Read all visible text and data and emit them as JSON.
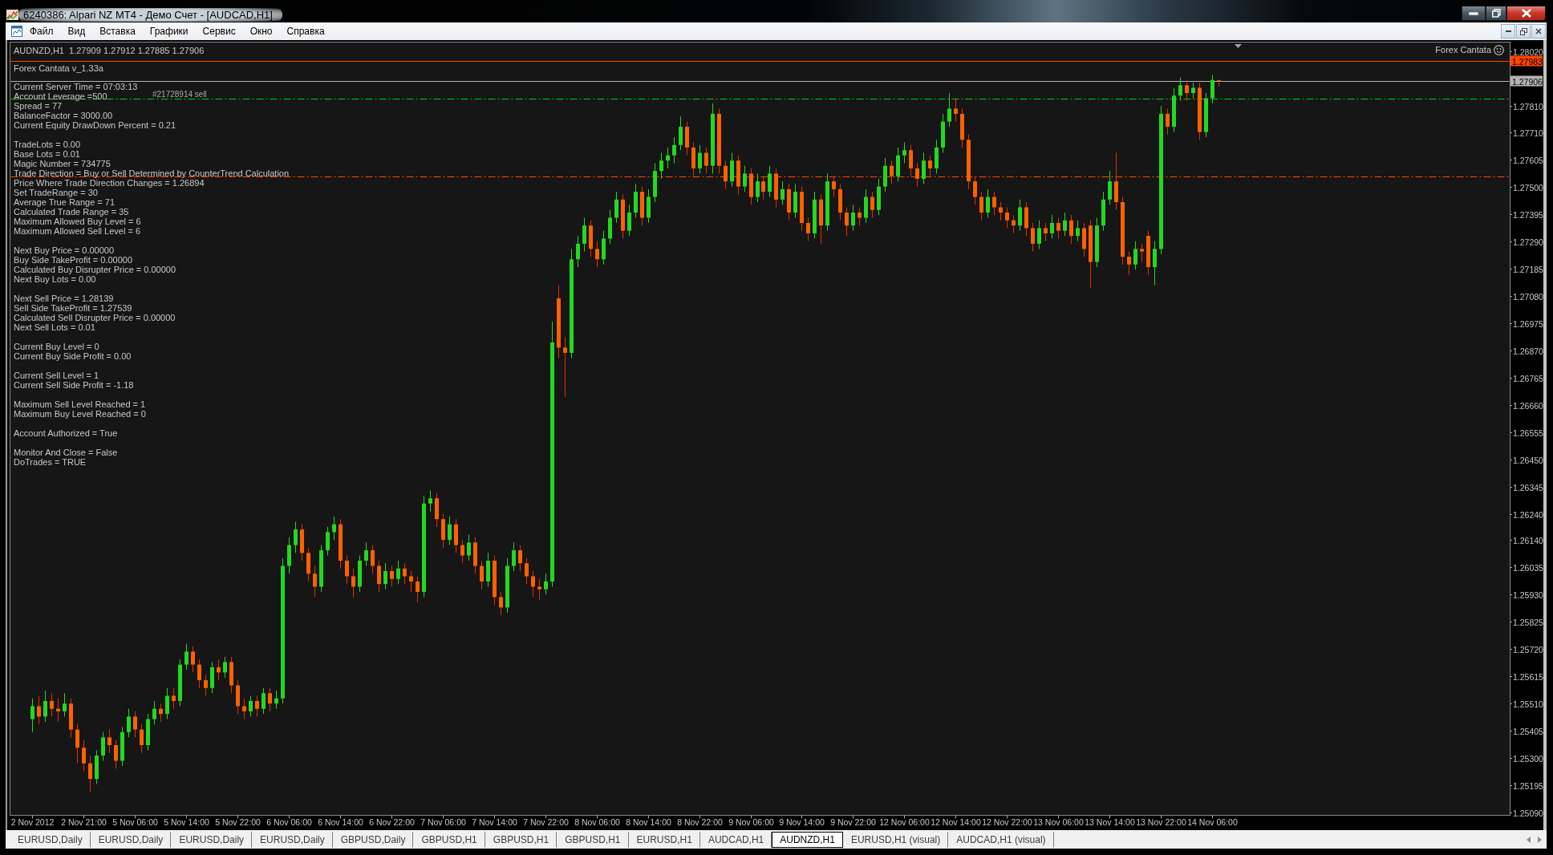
{
  "window": {
    "title": "6240386: Alpari NZ MT4 - Демо Счет - [AUDCAD,H1]"
  },
  "menu": [
    "Файл",
    "Вид",
    "Вставка",
    "Графики",
    "Сервис",
    "Окно",
    "Справка"
  ],
  "chart": {
    "expert_name": "Forex Cantata",
    "indicator": {
      "title": "Forex Cantata v_1.33a",
      "groups": [
        [
          "Current Server Time = 07:03:13",
          "Account Leverage =500",
          "Spread = 77",
          "BalanceFactor = 3000.00",
          "Current Equity DrawDown Percent = 0.21"
        ],
        [
          "TradeLots = 0.00",
          "Base Lots = 0.01",
          "Magic Number = 734775",
          "Trade Direction = Buy or Sell Determined by CounterTrend Calculation",
          "Price Where Trade Direction Changes = 1.26894",
          "Set TradeRange = 30",
          "Average True Range = 71",
          "Calculated Trade Range = 35",
          "Maximum Allowed Buy Level = 6",
          "Maximum Allowed Sell Level = 6"
        ],
        [
          "Next Buy Price = 0.00000",
          "Buy Side TakeProfit = 0.00000",
          "Calculated Buy Disrupter Price = 0.00000",
          "Next Buy Lots = 0.00"
        ],
        [
          "Next Sell Price = 1.28139",
          "Sell Side TakeProfit = 1.27539",
          "Calculated Sell Disrupter Price = 0.00000",
          "Next Sell Lots = 0.01"
        ],
        [
          "Current Buy Level = 0",
          "Current Buy Side Profit = 0.00"
        ],
        [
          "Current Sell Level = 1",
          "Current Sell Side Profit = -1.18"
        ],
        [
          "Maximum Sell Level Reached = 1",
          "Maximum Buy Level Reached = 0"
        ],
        [
          "Account Authorized = True"
        ],
        [
          "Monitor And Close = False",
          "DoTrades = TRUE"
        ]
      ]
    },
    "chart_data": {
      "type": "candlestick",
      "title": "AUDNZD,H1  1.27909 1.27912 1.27885 1.27906",
      "categories": [
        null,
        null,
        null,
        "2 Nov 2012",
        null,
        null,
        null,
        null,
        null,
        null,
        null,
        "2 Nov 21:00",
        null,
        null,
        null,
        null,
        null,
        null,
        null,
        "5 Nov 06:00",
        null,
        null,
        null,
        null,
        null,
        null,
        null,
        "5 Nov 14:00",
        null,
        null,
        null,
        null,
        null,
        null,
        null,
        "5 Nov 22:00",
        null,
        null,
        null,
        null,
        null,
        null,
        null,
        "6 Nov 06:00",
        null,
        null,
        null,
        null,
        null,
        null,
        null,
        "6 Nov 14:00",
        null,
        null,
        null,
        null,
        null,
        null,
        null,
        "6 Nov 22:00",
        null,
        null,
        null,
        null,
        null,
        null,
        null,
        "7 Nov 06:00",
        null,
        null,
        null,
        null,
        null,
        null,
        null,
        "7 Nov 14:00",
        null,
        null,
        null,
        null,
        null,
        null,
        null,
        "7 Nov 22:00",
        null,
        null,
        null,
        null,
        null,
        null,
        null,
        "8 Nov 06:00",
        null,
        null,
        null,
        null,
        null,
        null,
        null,
        "8 Nov 14:00",
        null,
        null,
        null,
        null,
        null,
        null,
        null,
        "8 Nov 22:00",
        null,
        null,
        null,
        null,
        null,
        null,
        null,
        "9 Nov 06:00",
        null,
        null,
        null,
        null,
        null,
        null,
        null,
        "9 Nov 14:00",
        null,
        null,
        null,
        null,
        null,
        null,
        null,
        "9 Nov 22:00",
        null,
        null,
        null,
        null,
        null,
        null,
        null,
        "12 Nov 06:00",
        null,
        null,
        null,
        null,
        null,
        null,
        null,
        "12 Nov 14:00",
        null,
        null,
        null,
        null,
        null,
        null,
        null,
        "12 Nov 22:00",
        null,
        null,
        null,
        null,
        null,
        null,
        null,
        "13 Nov 06:00",
        null,
        null,
        null,
        null,
        null,
        null,
        null,
        "13 Nov 14:00",
        null,
        null,
        null,
        null,
        null,
        null,
        null,
        "13 Nov 22:00",
        null,
        null,
        null,
        null,
        null,
        null,
        null,
        "14 Nov 06:00",
        null,
        null,
        null,
        null,
        null,
        null,
        null,
        null,
        null,
        null,
        null,
        null,
        null,
        null,
        null,
        null,
        null,
        null,
        null,
        null,
        null,
        null,
        null,
        null,
        null,
        null,
        null,
        null,
        null,
        null,
        null,
        null,
        null,
        null,
        null,
        null,
        null,
        null,
        null,
        null,
        null,
        null,
        null,
        null,
        null,
        null
      ],
      "ohlc": [
        null,
        null,
        null,
        [
          1.2545,
          1.2553,
          1.254,
          1.255
        ],
        [
          1.255,
          1.2554,
          1.2543,
          1.2546
        ],
        [
          1.2546,
          1.2556,
          1.2544,
          1.2552
        ],
        [
          1.2552,
          1.2555,
          1.2546,
          1.2549
        ],
        [
          1.2549,
          1.2553,
          1.2544,
          1.2548
        ],
        [
          1.2548,
          1.2555,
          1.2546,
          1.2551
        ],
        [
          1.2551,
          1.2553,
          1.2538,
          1.2541
        ],
        [
          1.2541,
          1.2543,
          1.2528,
          1.2534
        ],
        [
          1.2534,
          1.2537,
          1.2525,
          1.2528
        ],
        [
          1.2528,
          1.2531,
          1.2517,
          1.2522
        ],
        [
          1.2522,
          1.2533,
          1.252,
          1.2531
        ],
        [
          1.2531,
          1.254,
          1.2529,
          1.2538
        ],
        [
          1.2538,
          1.2541,
          1.2532,
          1.2535
        ],
        [
          1.2535,
          1.2537,
          1.2526,
          1.2529
        ],
        [
          1.2529,
          1.2542,
          1.2527,
          1.254
        ],
        [
          1.254,
          1.2549,
          1.2538,
          1.2546
        ],
        [
          1.2546,
          1.2548,
          1.2538,
          1.2541
        ],
        [
          1.2541,
          1.2543,
          1.2532,
          1.2535
        ],
        [
          1.2535,
          1.2547,
          1.2533,
          1.2545
        ],
        [
          1.2545,
          1.2552,
          1.2543,
          1.2549
        ],
        [
          1.2549,
          1.2551,
          1.2544,
          1.2547
        ],
        [
          1.2547,
          1.2557,
          1.2545,
          1.2554
        ],
        [
          1.2554,
          1.2557,
          1.2549,
          1.2552
        ],
        [
          1.2552,
          1.2568,
          1.255,
          1.2566
        ],
        [
          1.2566,
          1.2574,
          1.2564,
          1.2571
        ],
        [
          1.2571,
          1.2573,
          1.2563,
          1.2566
        ],
        [
          1.2566,
          1.2568,
          1.2557,
          1.256
        ],
        [
          1.256,
          1.2562,
          1.2554,
          1.2557
        ],
        [
          1.2557,
          1.2567,
          1.2555,
          1.2565
        ],
        [
          1.2565,
          1.2568,
          1.256,
          1.2563
        ],
        [
          1.2563,
          1.2569,
          1.2561,
          1.2567
        ],
        [
          1.2567,
          1.2569,
          1.2555,
          1.2558
        ],
        [
          1.2558,
          1.256,
          1.2547,
          1.255
        ],
        [
          1.255,
          1.2553,
          1.2545,
          1.2548
        ],
        [
          1.2548,
          1.2554,
          1.2546,
          1.2552
        ],
        [
          1.2552,
          1.2554,
          1.2546,
          1.2549
        ],
        [
          1.2549,
          1.2557,
          1.2547,
          1.2555
        ],
        [
          1.2555,
          1.2557,
          1.2548,
          1.2551
        ],
        [
          1.2551,
          1.2556,
          1.2549,
          1.2553
        ],
        [
          1.2553,
          1.2607,
          1.2551,
          1.2604
        ],
        [
          1.2604,
          1.2615,
          1.2601,
          1.2612
        ],
        [
          1.2612,
          1.2621,
          1.2609,
          1.2618
        ],
        [
          1.2618,
          1.262,
          1.2606,
          1.2609
        ],
        [
          1.2609,
          1.2611,
          1.2598,
          1.2601
        ],
        [
          1.2601,
          1.2604,
          1.2592,
          1.2596
        ],
        [
          1.2596,
          1.2612,
          1.2594,
          1.261
        ],
        [
          1.261,
          1.2619,
          1.2608,
          1.2617
        ],
        [
          1.2617,
          1.2623,
          1.2614,
          1.262
        ],
        [
          1.262,
          1.2622,
          1.2603,
          1.2606
        ],
        [
          1.2606,
          1.2608,
          1.2597,
          1.26
        ],
        [
          1.26,
          1.2603,
          1.2592,
          1.2596
        ],
        [
          1.2596,
          1.2608,
          1.2594,
          1.2606
        ],
        [
          1.2606,
          1.2613,
          1.2604,
          1.261
        ],
        [
          1.261,
          1.2612,
          1.2601,
          1.2604
        ],
        [
          1.2604,
          1.2606,
          1.2594,
          1.2597
        ],
        [
          1.2597,
          1.2605,
          1.2595,
          1.2602
        ],
        [
          1.2602,
          1.2604,
          1.2596,
          1.2599
        ],
        [
          1.2599,
          1.2606,
          1.2597,
          1.2603
        ],
        [
          1.2603,
          1.2605,
          1.2597,
          1.26
        ],
        [
          1.26,
          1.2602,
          1.2594,
          1.2598
        ],
        [
          1.2598,
          1.26,
          1.259,
          1.2594
        ],
        [
          1.2594,
          1.2631,
          1.2592,
          1.2628
        ],
        [
          1.2628,
          1.2633,
          1.2625,
          1.263
        ],
        [
          1.263,
          1.2632,
          1.2619,
          1.2622
        ],
        [
          1.2622,
          1.2624,
          1.2611,
          1.2614
        ],
        [
          1.2614,
          1.2623,
          1.2612,
          1.262
        ],
        [
          1.262,
          1.2622,
          1.2609,
          1.2612
        ],
        [
          1.2612,
          1.2614,
          1.2605,
          1.2608
        ],
        [
          1.2608,
          1.2616,
          1.2606,
          1.2613
        ],
        [
          1.2613,
          1.2615,
          1.2601,
          1.2604
        ],
        [
          1.2604,
          1.2606,
          1.2595,
          1.2598
        ],
        [
          1.2598,
          1.2609,
          1.2596,
          1.2606
        ],
        [
          1.2606,
          1.2608,
          1.2589,
          1.2592
        ],
        [
          1.2592,
          1.2594,
          1.2585,
          1.2588
        ],
        [
          1.2588,
          1.2607,
          1.2586,
          1.2604
        ],
        [
          1.2604,
          1.2613,
          1.2602,
          1.261
        ],
        [
          1.261,
          1.2612,
          1.2602,
          1.2605
        ],
        [
          1.2605,
          1.2607,
          1.2597,
          1.26
        ],
        [
          1.26,
          1.2602,
          1.2592,
          1.2596
        ],
        [
          1.2596,
          1.2599,
          1.2591,
          1.2595
        ],
        [
          1.2595,
          1.2601,
          1.2593,
          1.2598
        ],
        [
          1.2598,
          1.2698,
          1.2596,
          1.269
        ],
        [
          1.2707,
          1.2712,
          1.2684,
          1.2688
        ],
        [
          1.2688,
          1.2692,
          1.2669,
          1.2686
        ],
        [
          1.2686,
          1.2726,
          1.2684,
          1.2722
        ],
        [
          1.2722,
          1.2731,
          1.2719,
          1.2728
        ],
        [
          1.2728,
          1.2738,
          1.2725,
          1.2735
        ],
        [
          1.2735,
          1.2737,
          1.2723,
          1.2726
        ],
        [
          1.2726,
          1.2729,
          1.2719,
          1.2722
        ],
        [
          1.2722,
          1.2733,
          1.272,
          1.273
        ],
        [
          1.273,
          1.2741,
          1.2728,
          1.2738
        ],
        [
          1.2738,
          1.2748,
          1.2736,
          1.2745
        ],
        [
          1.2745,
          1.2747,
          1.273,
          1.2733
        ],
        [
          1.2733,
          1.2743,
          1.2731,
          1.274
        ],
        [
          1.274,
          1.2751,
          1.2738,
          1.2748
        ],
        [
          1.2748,
          1.275,
          1.2735,
          1.2738
        ],
        [
          1.2738,
          1.2749,
          1.2736,
          1.2746
        ],
        [
          1.2746,
          1.2759,
          1.2744,
          1.2756
        ],
        [
          1.2756,
          1.2763,
          1.2753,
          1.276
        ],
        [
          1.276,
          1.2765,
          1.2757,
          1.2762
        ],
        [
          1.2762,
          1.2769,
          1.2759,
          1.2766
        ],
        [
          1.2766,
          1.2777,
          1.2764,
          1.2773
        ],
        [
          1.2773,
          1.2775,
          1.2762,
          1.2765
        ],
        [
          1.2765,
          1.2767,
          1.2754,
          1.2757
        ],
        [
          1.2757,
          1.2766,
          1.2755,
          1.2763
        ],
        [
          1.2763,
          1.2765,
          1.2755,
          1.2758
        ],
        [
          1.2758,
          1.2782,
          1.2755,
          1.2778
        ],
        [
          1.2778,
          1.278,
          1.2755,
          1.2758
        ],
        [
          1.2758,
          1.276,
          1.2749,
          1.2752
        ],
        [
          1.2752,
          1.2763,
          1.275,
          1.276
        ],
        [
          1.276,
          1.2762,
          1.2747,
          1.275
        ],
        [
          1.275,
          1.2758,
          1.2748,
          1.2755
        ],
        [
          1.2755,
          1.2757,
          1.2743,
          1.2746
        ],
        [
          1.2746,
          1.2755,
          1.2744,
          1.2752
        ],
        [
          1.2752,
          1.2754,
          1.2745,
          1.2748
        ],
        [
          1.2748,
          1.2758,
          1.2746,
          1.2755
        ],
        [
          1.2755,
          1.2757,
          1.2742,
          1.2745
        ],
        [
          1.2745,
          1.2752,
          1.2743,
          1.2749
        ],
        [
          1.2749,
          1.2751,
          1.2737,
          1.274
        ],
        [
          1.274,
          1.2751,
          1.2738,
          1.2748
        ],
        [
          1.2748,
          1.275,
          1.2733,
          1.2736
        ],
        [
          1.2736,
          1.2738,
          1.2729,
          1.2732
        ],
        [
          1.2732,
          1.2748,
          1.273,
          1.2745
        ],
        [
          1.2745,
          1.2747,
          1.2728,
          1.2735
        ],
        [
          1.2735,
          1.2755,
          1.2733,
          1.2752
        ],
        [
          1.2752,
          1.2754,
          1.2746,
          1.2749
        ],
        [
          1.2749,
          1.2751,
          1.2737,
          1.274
        ],
        [
          1.274,
          1.2742,
          1.2731,
          1.2735
        ],
        [
          1.2735,
          1.2743,
          1.2733,
          1.274
        ],
        [
          1.274,
          1.2742,
          1.2735,
          1.2738
        ],
        [
          1.2738,
          1.2749,
          1.2736,
          1.2746
        ],
        [
          1.2746,
          1.2748,
          1.2738,
          1.2741
        ],
        [
          1.2741,
          1.2753,
          1.2739,
          1.275
        ],
        [
          1.275,
          1.2761,
          1.2748,
          1.2758
        ],
        [
          1.2758,
          1.276,
          1.2751,
          1.2754
        ],
        [
          1.2754,
          1.2765,
          1.2752,
          1.2762
        ],
        [
          1.2762,
          1.2767,
          1.2759,
          1.2764
        ],
        [
          1.2764,
          1.2766,
          1.2754,
          1.2757
        ],
        [
          1.2757,
          1.2759,
          1.275,
          1.2753
        ],
        [
          1.2753,
          1.2763,
          1.2751,
          1.276
        ],
        [
          1.276,
          1.2762,
          1.2754,
          1.2757
        ],
        [
          1.2757,
          1.2768,
          1.2755,
          1.2765
        ],
        [
          1.2765,
          1.2778,
          1.2763,
          1.2775
        ],
        [
          1.2775,
          1.2786,
          1.2773,
          1.278
        ],
        [
          1.278,
          1.2784,
          1.2775,
          1.2778
        ],
        [
          1.2778,
          1.278,
          1.2765,
          1.2768
        ],
        [
          1.2768,
          1.277,
          1.2749,
          1.2752
        ],
        [
          1.2752,
          1.2754,
          1.2743,
          1.2746
        ],
        [
          1.2746,
          1.2748,
          1.2737,
          1.274
        ],
        [
          1.274,
          1.2749,
          1.2738,
          1.2746
        ],
        [
          1.2746,
          1.2748,
          1.2739,
          1.2742
        ],
        [
          1.2742,
          1.2744,
          1.2737,
          1.274
        ],
        [
          1.274,
          1.2742,
          1.2734,
          1.2737
        ],
        [
          1.2737,
          1.2739,
          1.2732,
          1.2735
        ],
        [
          1.2735,
          1.2745,
          1.2733,
          1.2742
        ],
        [
          1.2742,
          1.2744,
          1.2731,
          1.2734
        ],
        [
          1.2734,
          1.2736,
          1.2725,
          1.2728
        ],
        [
          1.2728,
          1.2737,
          1.2726,
          1.2734
        ],
        [
          1.2734,
          1.2736,
          1.2729,
          1.2732
        ],
        [
          1.2732,
          1.2739,
          1.273,
          1.2736
        ],
        [
          1.2736,
          1.2738,
          1.273,
          1.2733
        ],
        [
          1.2733,
          1.274,
          1.2731,
          1.2737
        ],
        [
          1.2737,
          1.2739,
          1.2728,
          1.2731
        ],
        [
          1.2731,
          1.2737,
          1.2729,
          1.2734
        ],
        [
          1.2734,
          1.2736,
          1.2723,
          1.2726
        ],
        [
          1.2735,
          1.2737,
          1.2711,
          1.2721
        ],
        [
          1.2721,
          1.2738,
          1.2719,
          1.2735
        ],
        [
          1.2735,
          1.2748,
          1.2733,
          1.2745
        ],
        [
          1.2745,
          1.2756,
          1.2743,
          1.2752
        ],
        [
          1.2752,
          1.2763,
          1.2741,
          1.2744
        ],
        [
          1.2744,
          1.2746,
          1.272,
          1.2723
        ],
        [
          1.2723,
          1.2725,
          1.2716,
          1.272
        ],
        [
          1.272,
          1.2729,
          1.2718,
          1.2726
        ],
        [
          1.2726,
          1.2728,
          1.2721,
          1.2725
        ],
        [
          1.2731,
          1.2733,
          1.2716,
          1.2719
        ],
        [
          1.2719,
          1.2729,
          1.2712,
          1.2726
        ],
        [
          1.2726,
          1.2781,
          1.2724,
          1.2778
        ],
        [
          1.2778,
          1.278,
          1.277,
          1.2773
        ],
        [
          1.2773,
          1.2788,
          1.2771,
          1.2785
        ],
        [
          1.2785,
          1.2792,
          1.2783,
          1.2789
        ],
        [
          1.2789,
          1.2791,
          1.2783,
          1.2786
        ],
        [
          1.2786,
          1.279,
          1.2784,
          1.2788
        ],
        [
          1.2788,
          1.279,
          1.2768,
          1.2771
        ],
        [
          1.2771,
          1.2786,
          1.2769,
          1.2784
        ],
        [
          1.2784,
          1.2793,
          1.2782,
          1.2791
        ],
        [
          1.27909,
          1.27912,
          1.27885,
          1.27906
        ],
        null,
        null,
        null,
        null,
        null,
        null,
        null,
        null,
        null,
        null,
        null,
        null,
        null,
        null,
        null,
        null,
        null,
        null,
        null,
        null,
        null,
        null,
        null,
        null,
        null,
        null,
        null,
        null,
        null,
        null,
        null,
        null,
        null,
        null,
        null,
        null,
        null,
        null,
        null,
        null,
        null,
        null,
        null,
        null,
        null
      ],
      "ylim": [
        1.2508,
        1.28056
      ],
      "yticks": [
        {
          "value": 1.2802,
          "label": "1.28020"
        },
        {
          "value": 1.2781,
          "label": "1.27810"
        },
        {
          "value": 1.2771,
          "label": "1.27710"
        },
        {
          "value": 1.27605,
          "label": "1.27605"
        },
        {
          "value": 1.275,
          "label": "1.27500"
        },
        {
          "value": 1.27395,
          "label": "1.27395"
        },
        {
          "value": 1.2729,
          "label": "1.27290"
        },
        {
          "value": 1.27185,
          "label": "1.27185"
        },
        {
          "value": 1.2708,
          "label": "1.27080"
        },
        {
          "value": 1.26975,
          "label": "1.26975"
        },
        {
          "value": 1.2687,
          "label": "1.26870"
        },
        {
          "value": 1.26765,
          "label": "1.26765"
        },
        {
          "value": 1.2666,
          "label": "1.26660"
        },
        {
          "value": 1.26555,
          "label": "1.26555"
        },
        {
          "value": 1.2645,
          "label": "1.26450"
        },
        {
          "value": 1.26345,
          "label": "1.26345"
        },
        {
          "value": 1.2624,
          "label": "1.26240"
        },
        {
          "value": 1.2614,
          "label": "1.26140"
        },
        {
          "value": 1.26035,
          "label": "1.26035"
        },
        {
          "value": 1.2593,
          "label": "1.25930"
        },
        {
          "value": 1.25825,
          "label": "1.25825"
        },
        {
          "value": 1.2572,
          "label": "1.25720"
        },
        {
          "value": 1.25615,
          "label": "1.25615"
        },
        {
          "value": 1.2551,
          "label": "1.25510"
        },
        {
          "value": 1.25405,
          "label": "1.25405"
        },
        {
          "value": 1.253,
          "label": "1.25300"
        },
        {
          "value": 1.25195,
          "label": "1.25195"
        },
        {
          "value": 1.2509,
          "label": "1.25090"
        }
      ],
      "ref_lines": [
        {
          "axis": "y",
          "value": 1.27983,
          "label": "1.27983",
          "color": "#ff4500",
          "line_style": "solid"
        },
        {
          "axis": "y",
          "value": 1.27906,
          "label": "1.27906",
          "color": "#b4b4b4",
          "line_style": "solid"
        },
        {
          "axis": "y",
          "value": 1.27839,
          "label": "#21728914 sell",
          "color": "#00d000",
          "line_style": "dashdot"
        },
        {
          "axis": "y",
          "value": 1.27539,
          "color": "#ff4500",
          "line_style": "dashdot"
        }
      ]
    }
  },
  "tabs": [
    {
      "label": "EURUSD,Daily",
      "selected": false
    },
    {
      "label": "EURUSD,Daily",
      "selected": false
    },
    {
      "label": "EURUSD,Daily",
      "selected": false
    },
    {
      "label": "EURUSD,Daily",
      "selected": false
    },
    {
      "label": "GBPUSD,Daily",
      "selected": false
    },
    {
      "label": "GBPUSD,H1",
      "selected": false
    },
    {
      "label": "GBPUSD,H1",
      "selected": false
    },
    {
      "label": "GBPUSD,H1",
      "selected": false
    },
    {
      "label": "EURUSD,H1",
      "selected": false
    },
    {
      "label": "AUDCAD,H1",
      "selected": false
    },
    {
      "label": "AUDNZD,H1",
      "selected": true
    },
    {
      "label": "EURUSD,H1 (visual)",
      "selected": false
    },
    {
      "label": "AUDCAD,H1 (visual)",
      "selected": false
    }
  ]
}
